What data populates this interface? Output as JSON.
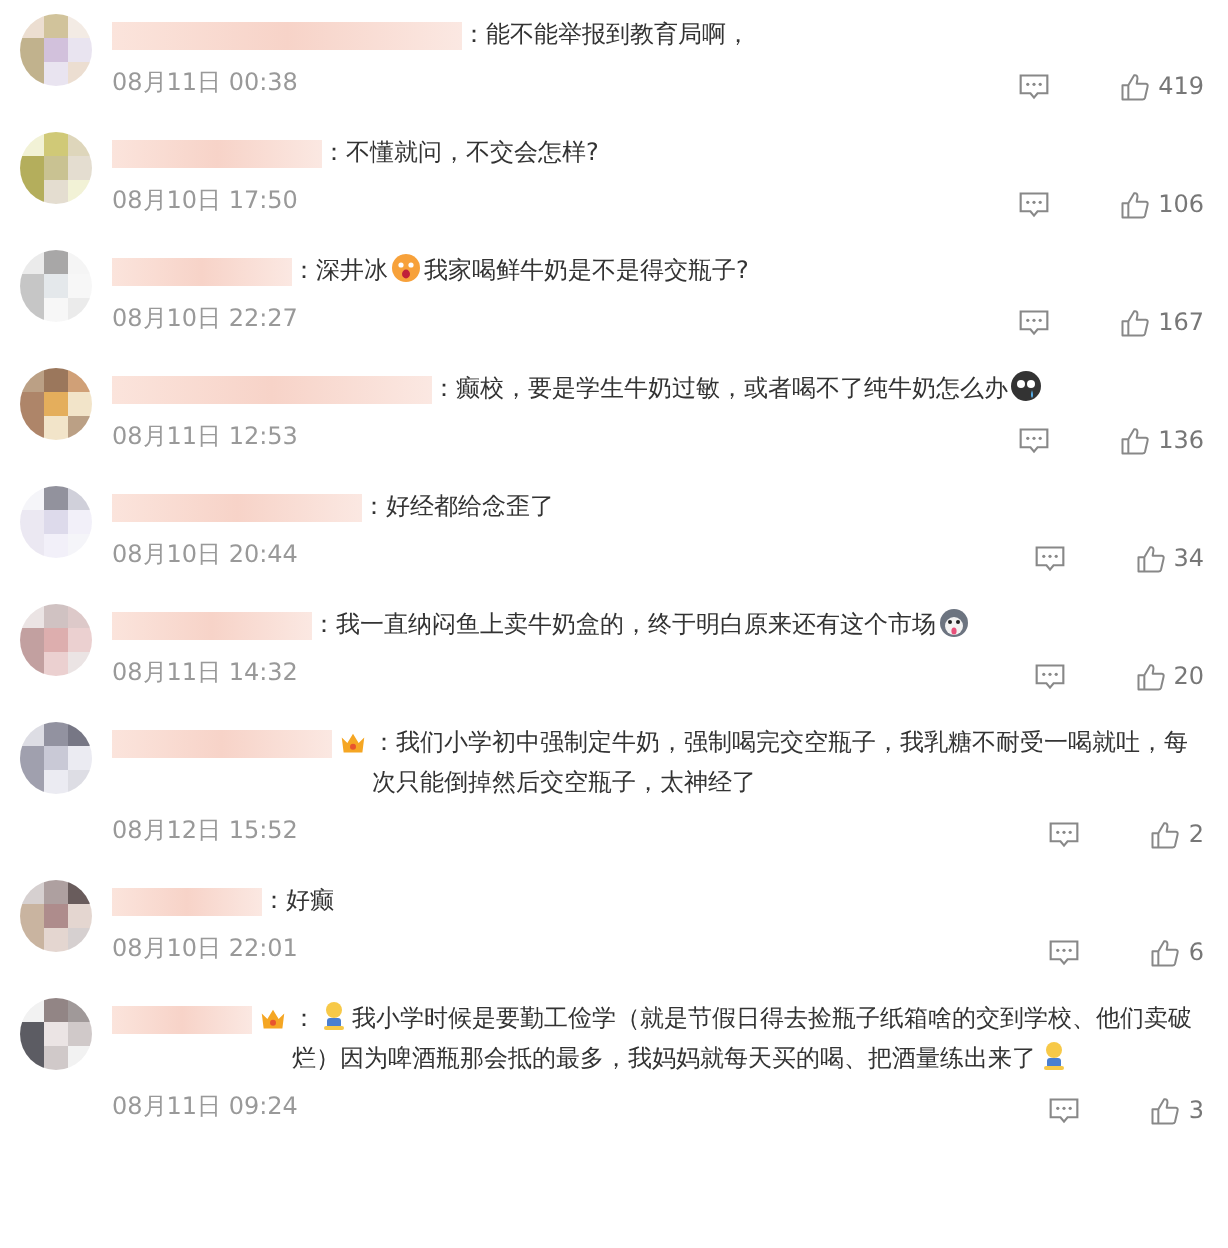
{
  "comments": [
    {
      "badge": false,
      "segments": [
        {
          "kind": "text",
          "text": "：能不能举报到教育局啊，"
        }
      ],
      "date": "08月11日 00:38",
      "likes": "419"
    },
    {
      "badge": false,
      "segments": [
        {
          "kind": "text",
          "text": "：不懂就问，不交会怎样?"
        }
      ],
      "date": "08月10日 17:50",
      "likes": "106"
    },
    {
      "badge": false,
      "segments": [
        {
          "kind": "text",
          "text": "：深井冰"
        },
        {
          "kind": "shock"
        },
        {
          "kind": "text",
          "text": "我家喝鲜牛奶是不是得交瓶子?"
        }
      ],
      "date": "08月10日 22:27",
      "likes": "167"
    },
    {
      "badge": false,
      "segments": [
        {
          "kind": "text",
          "text": "：癫校，要是学生牛奶过敏，或者喝不了纯牛奶怎么办"
        },
        {
          "kind": "sob"
        }
      ],
      "date": "08月11日 12:53",
      "likes": "136"
    },
    {
      "badge": false,
      "segments": [
        {
          "kind": "text",
          "text": "：好经都给念歪了"
        }
      ],
      "date": "08月10日 20:44",
      "likes": "34"
    },
    {
      "badge": false,
      "segments": [
        {
          "kind": "text",
          "text": "：我一直纳闷鱼上卖牛奶盒的，终于明白原来还有这个市场"
        },
        {
          "kind": "dog"
        }
      ],
      "date": "08月11日 14:32",
      "likes": "20"
    },
    {
      "badge": true,
      "segments": [
        {
          "kind": "text",
          "text": "：我们小学初中强制定牛奶，强制喝完交空瓶子，我乳糖不耐受一喝就吐，每次只能倒掉然后交空瓶子，太神经了"
        }
      ],
      "date": "08月12日 15:52",
      "likes": "2"
    },
    {
      "badge": false,
      "segments": [
        {
          "kind": "text",
          "text": "：好癫"
        }
      ],
      "date": "08月10日 22:01",
      "likes": "6"
    },
    {
      "badge": true,
      "segments": [
        {
          "kind": "text",
          "text": "："
        },
        {
          "kind": "kneel"
        },
        {
          "kind": "text",
          "text": "我小学时候是要勤工俭学（就是节假日得去捡瓶子纸箱啥的交到学校、他们卖破烂）因为啤酒瓶那会抵的最多，我妈妈就每天买的喝、把酒量练出来了"
        },
        {
          "kind": "kneel"
        }
      ],
      "date": "08月11日 09:24",
      "likes": "3"
    }
  ]
}
